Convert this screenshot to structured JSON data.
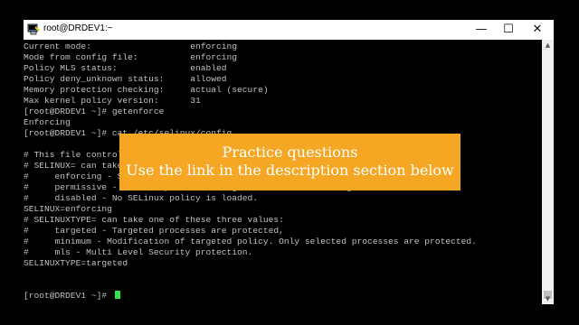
{
  "window": {
    "title": "root@DRDEV1:~",
    "icon": "putty-terminal-icon",
    "controls": {
      "minimize": "—",
      "maximize": "☐",
      "close": "✕"
    }
  },
  "terminal": {
    "lines": [
      "Current mode:                   enforcing",
      "Mode from config file:          enforcing",
      "Policy MLS status:              enabled",
      "Policy deny_unknown status:     allowed",
      "Memory protection checking:     actual (secure)",
      "Max kernel policy version:      31",
      "[root@DRDEV1 ~]# getenforce",
      "Enforcing",
      "[root@DRDEV1 ~]# cat /etc/selinux/config",
      "",
      "# This file controls the state of SELinux on the system.",
      "# SELINUX= can take one of these three values:",
      "#     enforcing - SELinux security policy is enforced.",
      "#     permissive - SELinux prints warnings instead of enforcing.",
      "#     disabled - No SELinux policy is loaded.",
      "SELINUX=enforcing",
      "# SELINUXTYPE= can take one of these three values:",
      "#     targeted - Targeted processes are protected,",
      "#     minimum - Modification of targeted policy. Only selected processes are protected.",
      "#     mls - Multi Level Security protection.",
      "SELINUXTYPE=targeted",
      "",
      "",
      "[root@DRDEV1 ~]# "
    ],
    "cursor_color": "#2ee54a"
  },
  "overlay": {
    "line1": "Practice questions",
    "line2": "Use the link in the description section below",
    "background": "#f5a623"
  },
  "scrollbar": {
    "up": "▲",
    "down": "▼"
  }
}
